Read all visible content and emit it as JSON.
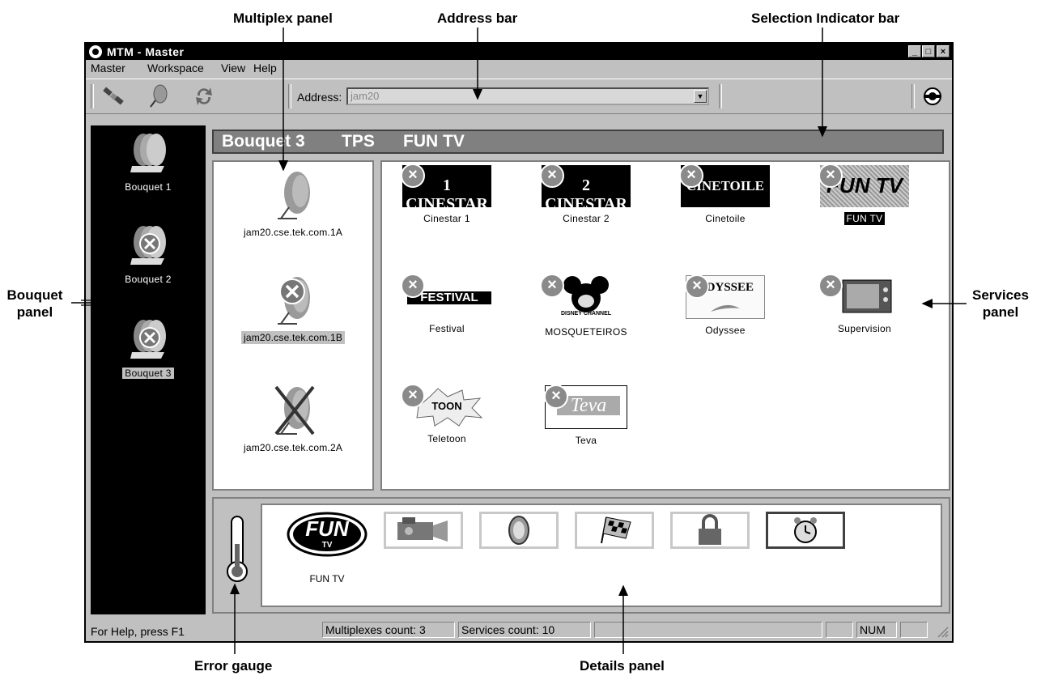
{
  "callouts": {
    "multiplex_panel": "Multiplex panel",
    "address_bar": "Address bar",
    "selection_indicator_bar": "Selection Indicator bar",
    "bouquet_panel_1": "Bouquet",
    "bouquet_panel_2": "panel",
    "services_panel_1": "Services",
    "services_panel_2": "panel",
    "error_gauge": "Error gauge",
    "details_panel": "Details panel"
  },
  "window": {
    "title": "MTM - Master",
    "controls": {
      "minimize": "_",
      "maximize": "□",
      "close": "×"
    }
  },
  "menu": {
    "master": "Master",
    "workspace": "Workspace",
    "view": "View",
    "help": "Help"
  },
  "toolbar": {
    "address_label": "Address:",
    "address_value": "jam20",
    "icons": [
      "satellite-icon",
      "dish-icon",
      "refresh-icon",
      "app-logo-icon"
    ]
  },
  "bouquets": [
    {
      "label": "Bouquet 1",
      "error": false,
      "selected": false
    },
    {
      "label": "Bouquet 2",
      "error": true,
      "selected": false
    },
    {
      "label": "Bouquet 3",
      "error": true,
      "selected": true
    }
  ],
  "selection": {
    "bouquet": "Bouquet 3",
    "network": "TPS",
    "service": "FUN TV"
  },
  "multiplexes": [
    {
      "label": "jam20.cse.tek.com.1A",
      "state": "ok",
      "selected": false
    },
    {
      "label": "jam20.cse.tek.com.1B",
      "state": "error",
      "selected": true
    },
    {
      "label": "jam20.cse.tek.com.2A",
      "state": "unavailable",
      "selected": false
    }
  ],
  "services": [
    {
      "label": "Cinestar 1",
      "logo_text": "1 CINESTAR",
      "selected": false
    },
    {
      "label": "Cinestar 2",
      "logo_text": "2 CINESTAR",
      "selected": false
    },
    {
      "label": "Cinetoile",
      "logo_text": "CINETOILE",
      "selected": false
    },
    {
      "label": "FUN TV",
      "logo_text": "FUN TV",
      "selected": true
    },
    {
      "label": "Festival",
      "logo_text": "FESTIVAL",
      "selected": false
    },
    {
      "label": "MOSQUETEIROS",
      "logo_text": "DISNEY CHANNEL",
      "selected": false
    },
    {
      "label": "Odyssee",
      "logo_text": "ODYSSEE",
      "selected": false
    },
    {
      "label": "Supervision",
      "logo_text": "",
      "selected": false
    },
    {
      "label": "Teletoon",
      "logo_text": "TOON",
      "selected": false
    },
    {
      "label": "Teva",
      "logo_text": "Teva",
      "selected": false
    }
  ],
  "details": {
    "service_name": "FUN TV",
    "logo_text": "FUN",
    "logo_sub": "TV",
    "icons": [
      "video-camera-icon",
      "speaker-icon",
      "checkered-flag-icon",
      "padlock-icon",
      "alarm-clock-icon"
    ]
  },
  "status": {
    "help": "For Help, press F1",
    "multiplexes": "Multiplexes count: 3",
    "services": "Services count: 10",
    "num": "NUM"
  }
}
